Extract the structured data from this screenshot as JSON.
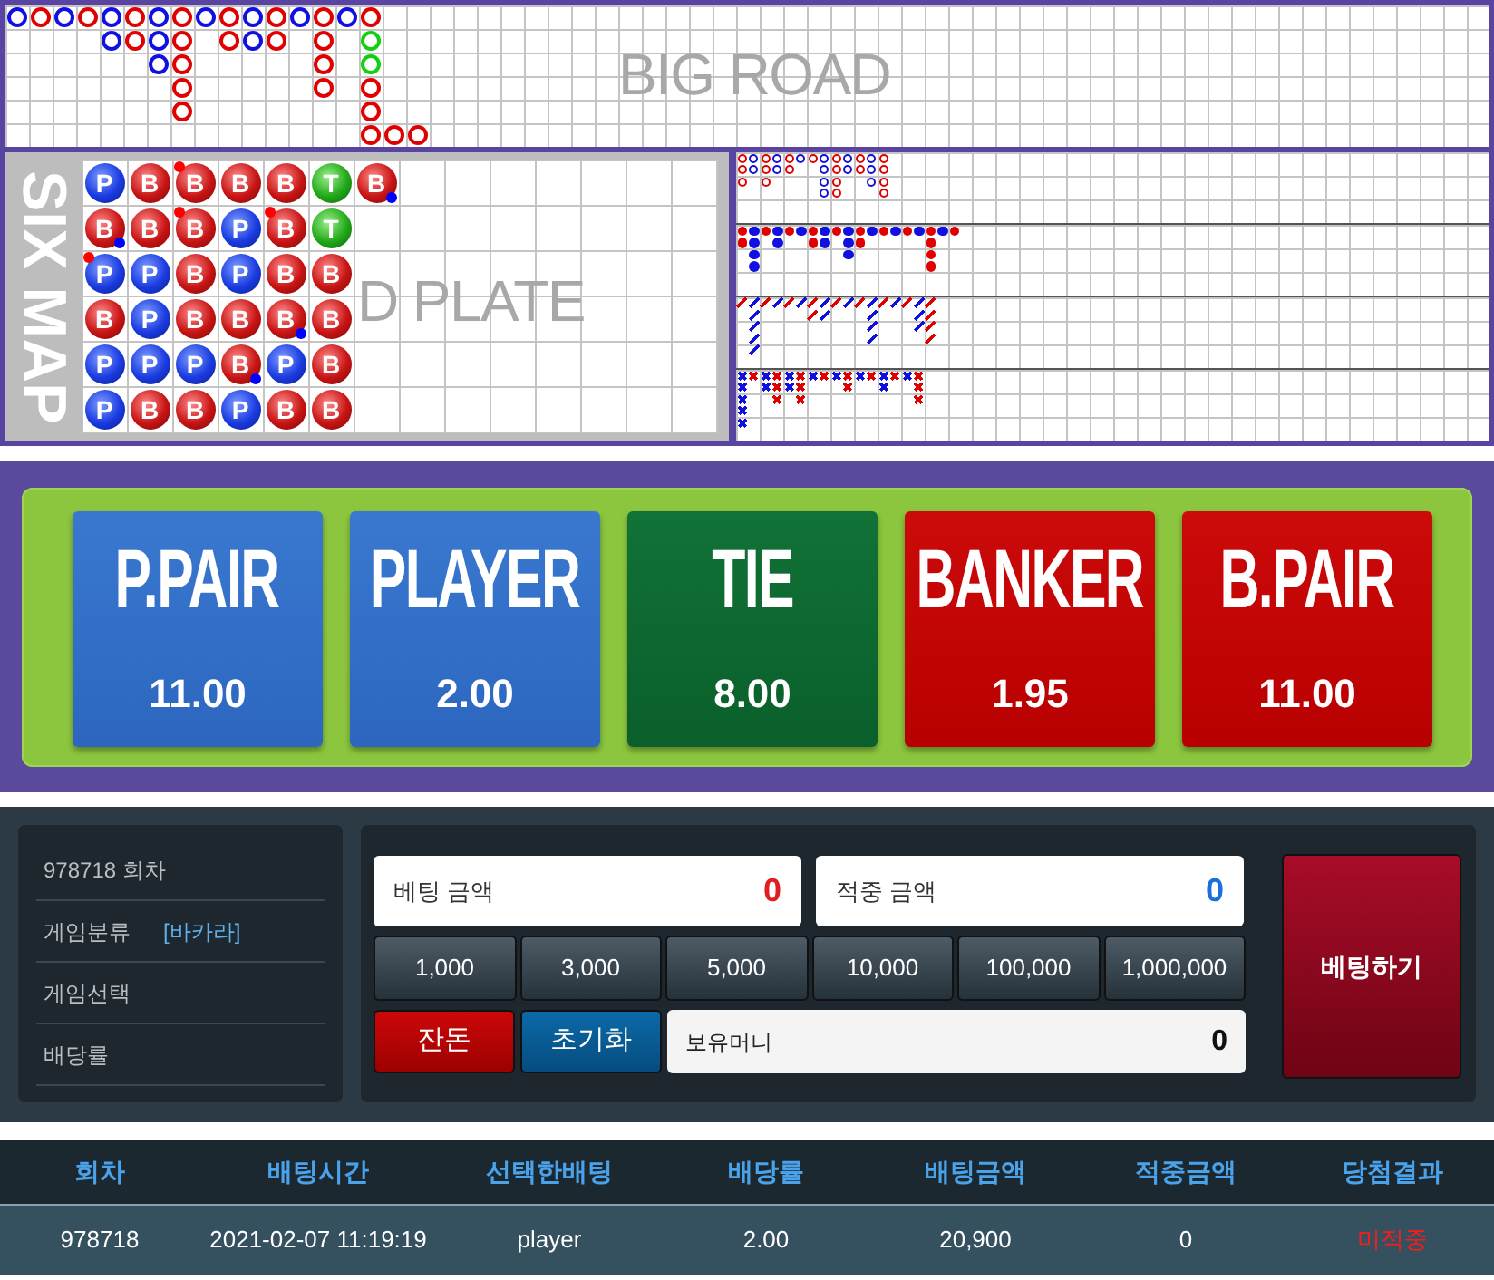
{
  "big_road": {
    "watermark": "BIG ROAD",
    "columns": [
      [
        {
          "color": "#1010e0"
        }
      ],
      [
        {
          "color": "#e00000"
        }
      ],
      [
        {
          "color": "#1010e0"
        }
      ],
      [
        {
          "color": "#e00000"
        }
      ],
      [
        {
          "color": "#1010e0"
        },
        {
          "color": "#1010e0"
        }
      ],
      [
        {
          "color": "#e00000"
        },
        {
          "color": "#e00000"
        }
      ],
      [
        {
          "color": "#1010e0"
        },
        {
          "color": "#1010e0"
        },
        {
          "color": "#1010e0"
        }
      ],
      [
        {
          "color": "#e00000"
        },
        {
          "color": "#e00000"
        },
        {
          "color": "#e00000"
        },
        {
          "color": "#e00000"
        },
        {
          "color": "#e00000"
        }
      ],
      [
        {
          "color": "#1010e0"
        }
      ],
      [
        {
          "color": "#e00000"
        },
        {
          "color": "#e00000"
        }
      ],
      [
        {
          "color": "#1010e0"
        },
        {
          "color": "#1010e0"
        }
      ],
      [
        {
          "color": "#e00000"
        },
        {
          "color": "#e00000"
        }
      ],
      [
        {
          "color": "#1010e0"
        }
      ],
      [
        {
          "color": "#e00000"
        },
        {
          "color": "#e00000"
        },
        {
          "color": "#e00000"
        },
        {
          "color": "#e00000"
        }
      ],
      [
        {
          "color": "#1010e0"
        }
      ],
      [
        {
          "color": "#e00000"
        },
        {
          "color": "#10d010"
        },
        {
          "color": "#10d010"
        },
        {
          "color": "#e00000"
        },
        {
          "color": "#e00000"
        },
        {
          "color": "#e00000"
        }
      ],
      [
        null,
        null,
        null,
        null,
        null,
        {
          "color": "#e00000"
        }
      ],
      [
        null,
        null,
        null,
        null,
        null,
        {
          "color": "#e00000"
        }
      ]
    ]
  },
  "six_map": {
    "title": "SIX MAP",
    "watermark": "D PLATE",
    "columns": [
      [
        {
          "kind": "player",
          "letter": "P",
          "banker_pair": false,
          "player_pair": false
        },
        {
          "kind": "banker",
          "letter": "B",
          "banker_pair": false,
          "player_pair": true
        },
        {
          "kind": "player",
          "letter": "P",
          "banker_pair": true,
          "player_pair": false
        },
        {
          "kind": "banker",
          "letter": "B",
          "banker_pair": false,
          "player_pair": false
        },
        {
          "kind": "player",
          "letter": "P",
          "banker_pair": false,
          "player_pair": false
        },
        {
          "kind": "player",
          "letter": "P",
          "banker_pair": false,
          "player_pair": false
        }
      ],
      [
        {
          "kind": "banker",
          "letter": "B",
          "banker_pair": false,
          "player_pair": false
        },
        {
          "kind": "banker",
          "letter": "B",
          "banker_pair": false,
          "player_pair": false
        },
        {
          "kind": "player",
          "letter": "P",
          "banker_pair": false,
          "player_pair": false
        },
        {
          "kind": "player",
          "letter": "P",
          "banker_pair": false,
          "player_pair": false
        },
        {
          "kind": "player",
          "letter": "P",
          "banker_pair": false,
          "player_pair": false
        },
        {
          "kind": "banker",
          "letter": "B",
          "banker_pair": false,
          "player_pair": false
        }
      ],
      [
        {
          "kind": "banker",
          "letter": "B",
          "banker_pair": true,
          "player_pair": false
        },
        {
          "kind": "banker",
          "letter": "B",
          "banker_pair": true,
          "player_pair": false
        },
        {
          "kind": "banker",
          "letter": "B",
          "banker_pair": false,
          "player_pair": false
        },
        {
          "kind": "banker",
          "letter": "B",
          "banker_pair": false,
          "player_pair": false
        },
        {
          "kind": "player",
          "letter": "P",
          "banker_pair": false,
          "player_pair": false
        },
        {
          "kind": "banker",
          "letter": "B",
          "banker_pair": false,
          "player_pair": false
        }
      ],
      [
        {
          "kind": "banker",
          "letter": "B",
          "banker_pair": false,
          "player_pair": false
        },
        {
          "kind": "player",
          "letter": "P",
          "banker_pair": false,
          "player_pair": false
        },
        {
          "kind": "player",
          "letter": "P",
          "banker_pair": false,
          "player_pair": false
        },
        {
          "kind": "banker",
          "letter": "B",
          "banker_pair": false,
          "player_pair": false
        },
        {
          "kind": "banker",
          "letter": "B",
          "banker_pair": false,
          "player_pair": true
        },
        {
          "kind": "player",
          "letter": "P",
          "banker_pair": false,
          "player_pair": false
        }
      ],
      [
        {
          "kind": "banker",
          "letter": "B",
          "banker_pair": false,
          "player_pair": false
        },
        {
          "kind": "banker",
          "letter": "B",
          "banker_pair": true,
          "player_pair": false
        },
        {
          "kind": "banker",
          "letter": "B",
          "banker_pair": false,
          "player_pair": false
        },
        {
          "kind": "banker",
          "letter": "B",
          "banker_pair": false,
          "player_pair": true
        },
        {
          "kind": "player",
          "letter": "P",
          "banker_pair": false,
          "player_pair": false
        },
        {
          "kind": "banker",
          "letter": "B",
          "banker_pair": false,
          "player_pair": false
        }
      ],
      [
        {
          "kind": "tie",
          "letter": "T",
          "banker_pair": false,
          "player_pair": false
        },
        {
          "kind": "tie",
          "letter": "T",
          "banker_pair": false,
          "player_pair": false
        },
        {
          "kind": "banker",
          "letter": "B",
          "banker_pair": false,
          "player_pair": false
        },
        {
          "kind": "banker",
          "letter": "B",
          "banker_pair": false,
          "player_pair": false
        },
        {
          "kind": "banker",
          "letter": "B",
          "banker_pair": false,
          "player_pair": false
        },
        {
          "kind": "banker",
          "letter": "B",
          "banker_pair": false,
          "player_pair": false
        }
      ],
      [
        {
          "kind": "banker",
          "letter": "B",
          "banker_pair": false,
          "player_pair": true
        }
      ]
    ]
  },
  "derived_roads": [
    {
      "kind": "ring",
      "columns": [
        [
          {
            "color": "#e00000"
          },
          {
            "color": "#e00000"
          },
          {
            "color": "#e00000"
          }
        ],
        [
          {
            "color": "#1010e0"
          },
          {
            "color": "#1010e0"
          }
        ],
        [
          {
            "color": "#e00000"
          },
          {
            "color": "#e00000"
          },
          {
            "color": "#e00000"
          }
        ],
        [
          {
            "color": "#1010e0"
          },
          {
            "color": "#1010e0"
          }
        ],
        [
          {
            "color": "#e00000"
          },
          {
            "color": "#e00000"
          }
        ],
        [
          {
            "color": "#1010e0"
          }
        ],
        [
          {
            "color": "#e00000"
          }
        ],
        [
          {
            "color": "#1010e0"
          },
          {
            "color": "#1010e0"
          },
          {
            "color": "#1010e0"
          },
          {
            "color": "#1010e0"
          }
        ],
        [
          {
            "color": "#e00000"
          },
          {
            "color": "#e00000"
          },
          {
            "color": "#e00000"
          },
          {
            "color": "#e00000"
          }
        ],
        [
          {
            "color": "#1010e0"
          },
          {
            "color": "#1010e0"
          }
        ],
        [
          {
            "color": "#e00000"
          },
          {
            "color": "#e00000"
          }
        ],
        [
          {
            "color": "#1010e0"
          },
          {
            "color": "#1010e0"
          },
          {
            "color": "#1010e0"
          }
        ],
        [
          {
            "color": "#e00000"
          },
          {
            "color": "#e00000"
          },
          {
            "color": "#e00000"
          },
          {
            "color": "#e00000"
          }
        ]
      ]
    },
    {
      "kind": "dot",
      "columns": [
        [
          {
            "color": "#e00000"
          },
          {
            "color": "#e00000"
          }
        ],
        [
          {
            "color": "#1010e0"
          },
          {
            "color": "#1010e0"
          },
          {
            "color": "#1010e0"
          },
          {
            "color": "#1010e0"
          }
        ],
        [
          {
            "color": "#e00000"
          }
        ],
        [
          {
            "color": "#1010e0"
          },
          {
            "color": "#1010e0"
          }
        ],
        [
          {
            "color": "#e00000"
          }
        ],
        [
          {
            "color": "#1010e0"
          }
        ],
        [
          {
            "color": "#e00000"
          },
          {
            "color": "#e00000"
          }
        ],
        [
          {
            "color": "#1010e0"
          },
          {
            "color": "#1010e0"
          }
        ],
        [
          {
            "color": "#e00000"
          }
        ],
        [
          {
            "color": "#1010e0"
          },
          {
            "color": "#1010e0"
          },
          {
            "color": "#1010e0"
          }
        ],
        [
          {
            "color": "#e00000"
          },
          {
            "color": "#e00000"
          }
        ],
        [
          {
            "color": "#1010e0"
          }
        ],
        [
          {
            "color": "#e00000"
          }
        ],
        [
          {
            "color": "#1010e0"
          }
        ],
        [
          {
            "color": "#e00000"
          }
        ],
        [
          {
            "color": "#1010e0"
          }
        ],
        [
          {
            "color": "#e00000"
          },
          {
            "color": "#e00000"
          },
          {
            "color": "#e00000"
          },
          {
            "color": "#e00000"
          }
        ],
        [
          {
            "color": "#1010e0"
          }
        ],
        [
          {
            "color": "#e00000"
          }
        ]
      ]
    },
    {
      "kind": "slash",
      "columns": [
        [
          {
            "color": "#e00000"
          }
        ],
        [
          {
            "color": "#1010e0"
          },
          {
            "color": "#1010e0"
          },
          {
            "color": "#1010e0"
          },
          {
            "color": "#1010e0"
          },
          {
            "color": "#1010e0"
          }
        ],
        [
          {
            "color": "#e00000"
          }
        ],
        [
          {
            "color": "#1010e0"
          }
        ],
        [
          {
            "color": "#e00000"
          }
        ],
        [
          {
            "color": "#1010e0"
          }
        ],
        [
          {
            "color": "#e00000"
          },
          {
            "color": "#e00000"
          }
        ],
        [
          {
            "color": "#1010e0"
          },
          {
            "color": "#1010e0"
          }
        ],
        [
          {
            "color": "#e00000"
          }
        ],
        [
          {
            "color": "#1010e0"
          }
        ],
        [
          {
            "color": "#e00000"
          }
        ],
        [
          {
            "color": "#1010e0"
          },
          {
            "color": "#1010e0"
          },
          {
            "color": "#1010e0"
          },
          {
            "color": "#1010e0"
          }
        ],
        [
          {
            "color": "#e00000"
          }
        ],
        [
          {
            "color": "#1010e0"
          }
        ],
        [
          {
            "color": "#e00000"
          }
        ],
        [
          {
            "color": "#1010e0"
          },
          {
            "color": "#1010e0"
          },
          {
            "color": "#1010e0"
          }
        ],
        [
          {
            "color": "#e00000"
          },
          {
            "color": "#e00000"
          },
          {
            "color": "#e00000"
          },
          {
            "color": "#e00000"
          }
        ]
      ]
    },
    {
      "kind": "cross",
      "columns": [
        [
          {
            "color": "#1010e0"
          },
          {
            "color": "#1010e0"
          },
          {
            "color": "#1010e0"
          },
          {
            "color": "#1010e0"
          },
          {
            "color": "#1010e0"
          }
        ],
        [
          {
            "color": "#e00000"
          }
        ],
        [
          {
            "color": "#1010e0"
          },
          {
            "color": "#1010e0"
          }
        ],
        [
          {
            "color": "#e00000"
          },
          {
            "color": "#e00000"
          },
          {
            "color": "#e00000"
          }
        ],
        [
          {
            "color": "#1010e0"
          },
          {
            "color": "#1010e0"
          }
        ],
        [
          {
            "color": "#e00000"
          },
          {
            "color": "#e00000"
          },
          {
            "color": "#e00000"
          }
        ],
        [
          {
            "color": "#1010e0"
          }
        ],
        [
          {
            "color": "#e00000"
          }
        ],
        [
          {
            "color": "#1010e0"
          }
        ],
        [
          {
            "color": "#e00000"
          },
          {
            "color": "#e00000"
          }
        ],
        [
          {
            "color": "#1010e0"
          }
        ],
        [
          {
            "color": "#e00000"
          }
        ],
        [
          {
            "color": "#1010e0"
          },
          {
            "color": "#1010e0"
          }
        ],
        [
          {
            "color": "#e00000"
          }
        ],
        [
          {
            "color": "#1010e0"
          }
        ],
        [
          {
            "color": "#e00000"
          },
          {
            "color": "#e00000"
          },
          {
            "color": "#e00000"
          }
        ]
      ]
    }
  ],
  "bet_options": [
    {
      "kind": "player",
      "label": "P.PAIR",
      "odds": "11.00"
    },
    {
      "kind": "player",
      "label": "PLAYER",
      "odds": "2.00"
    },
    {
      "kind": "tie",
      "label": "TIE",
      "odds": "8.00"
    },
    {
      "kind": "banker",
      "label": "BANKER",
      "odds": "1.95"
    },
    {
      "kind": "banker",
      "label": "B.PAIR",
      "odds": "11.00"
    }
  ],
  "info": {
    "round": "978718 회차",
    "game_type_label": "게임분류",
    "game_type": "[바카라]",
    "game_select_label": "게임선택",
    "odds_label": "배당률"
  },
  "bet_amount": {
    "label": "베팅 금액",
    "value": "0"
  },
  "win_amount": {
    "label": "적중 금액",
    "value": "0"
  },
  "chips": [
    "1,000",
    "3,000",
    "5,000",
    "10,000",
    "100,000",
    "1,000,000"
  ],
  "change_button": "잔돈",
  "reset_button": "초기화",
  "balance": {
    "label": "보유머니",
    "value": "0"
  },
  "bet_button": "베팅하기",
  "history": {
    "columns": [
      "회차",
      "배팅시간",
      "선택한배팅",
      "배당률",
      "배팅금액",
      "적중금액",
      "당첨결과"
    ],
    "rows": [
      {
        "cells": [
          "978718",
          "2021-02-07 11:19:19",
          "player",
          "2.00",
          "20,900",
          "0",
          "미적중"
        ],
        "won": false
      }
    ]
  }
}
